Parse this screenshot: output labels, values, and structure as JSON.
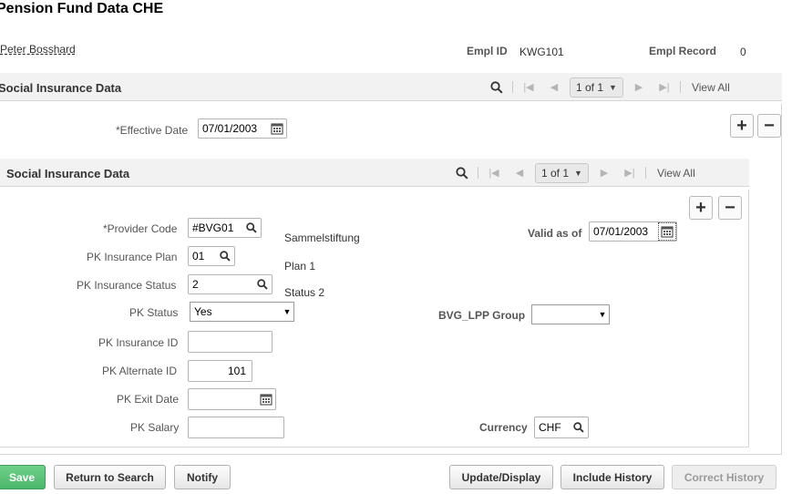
{
  "page": {
    "title": "Pension Fund Data CHE"
  },
  "employee": {
    "name": "Peter Bosshard",
    "empl_id_label": "Empl ID",
    "empl_id": "KWG101",
    "empl_record_label": "Empl Record",
    "empl_record": "0"
  },
  "outer_grid": {
    "title": "Social Insurance Data",
    "pager": "1 of 1",
    "view_all": "View All",
    "effective_date_label": "*Effective Date",
    "effective_date": "07/01/2003"
  },
  "inner_grid": {
    "title": "Social Insurance Data",
    "pager": "1 of 1",
    "view_all": "View All"
  },
  "form": {
    "provider_code_label": "*Provider Code",
    "provider_code": "#BVG01",
    "provider_desc": "Sammelstiftung",
    "valid_as_of_label": "Valid as of",
    "valid_as_of": "07/01/2003",
    "insurance_plan_label": "PK Insurance Plan",
    "insurance_plan": "01",
    "insurance_plan_desc": "Plan 1",
    "insurance_status_label": "PK Insurance Status",
    "insurance_status": "2",
    "insurance_status_desc": "Status 2",
    "pk_status_label": "PK Status",
    "pk_status": "Yes",
    "bvg_group_label": "BVG_LPP Group",
    "bvg_group": "",
    "insurance_id_label": "PK Insurance ID",
    "insurance_id": "",
    "alternate_id_label": "PK Alternate ID",
    "alternate_id": "101",
    "exit_date_label": "PK Exit Date",
    "exit_date": "",
    "salary_label": "PK Salary",
    "salary": "",
    "currency_label": "Currency",
    "currency": "CHF"
  },
  "buttons": {
    "save": "Save",
    "return_to_search": "Return to Search",
    "notify": "Notify",
    "update_display": "Update/Display",
    "include_history": "Include History",
    "correct_history": "Correct History"
  },
  "colors": {
    "save_green": "#4bb86a",
    "gridbar_bg": "#f2f2f2"
  }
}
